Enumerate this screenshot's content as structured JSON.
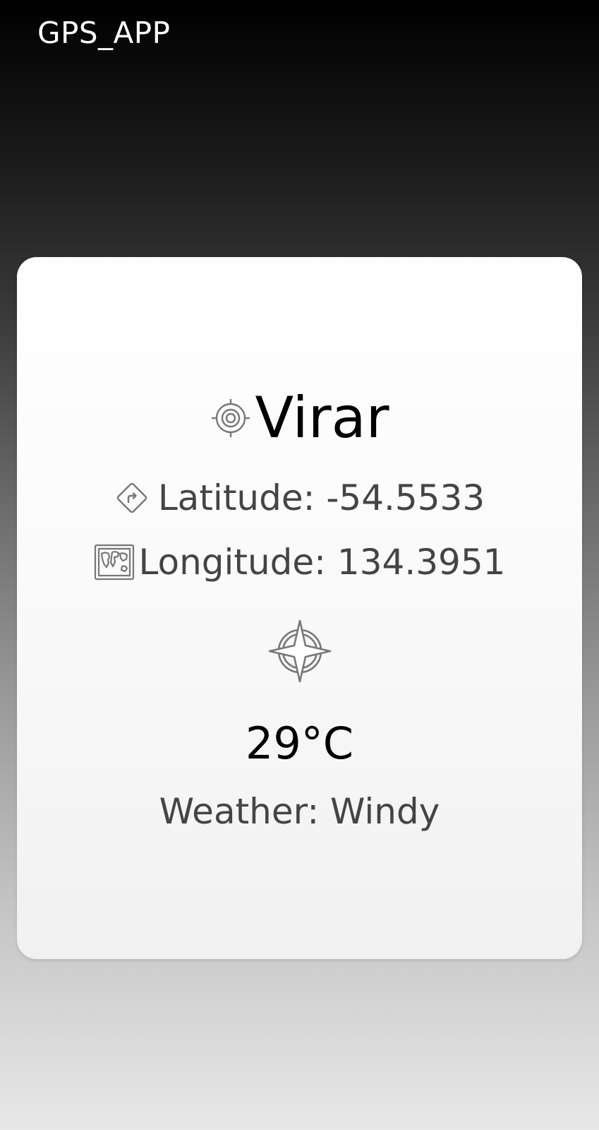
{
  "app": {
    "title": "GPS_APP"
  },
  "location": {
    "city": "Virar",
    "city_icon": "gps-target-icon",
    "latitude_text": "Latitude: -54.5533",
    "latitude_icon": "direction-sign-icon",
    "longitude_text": "Longitude: 134.3951",
    "longitude_icon": "world-map-icon"
  },
  "weather": {
    "icon": "compass-icon",
    "temperature": "29°C",
    "condition_text": "Weather: Windy"
  },
  "colors": {
    "background_top": "#000000",
    "background_bottom": "#e8e8e8",
    "card": "#fafafa",
    "primary_text": "#000000",
    "secondary_text": "#444444",
    "icon_stroke": "#777777"
  }
}
